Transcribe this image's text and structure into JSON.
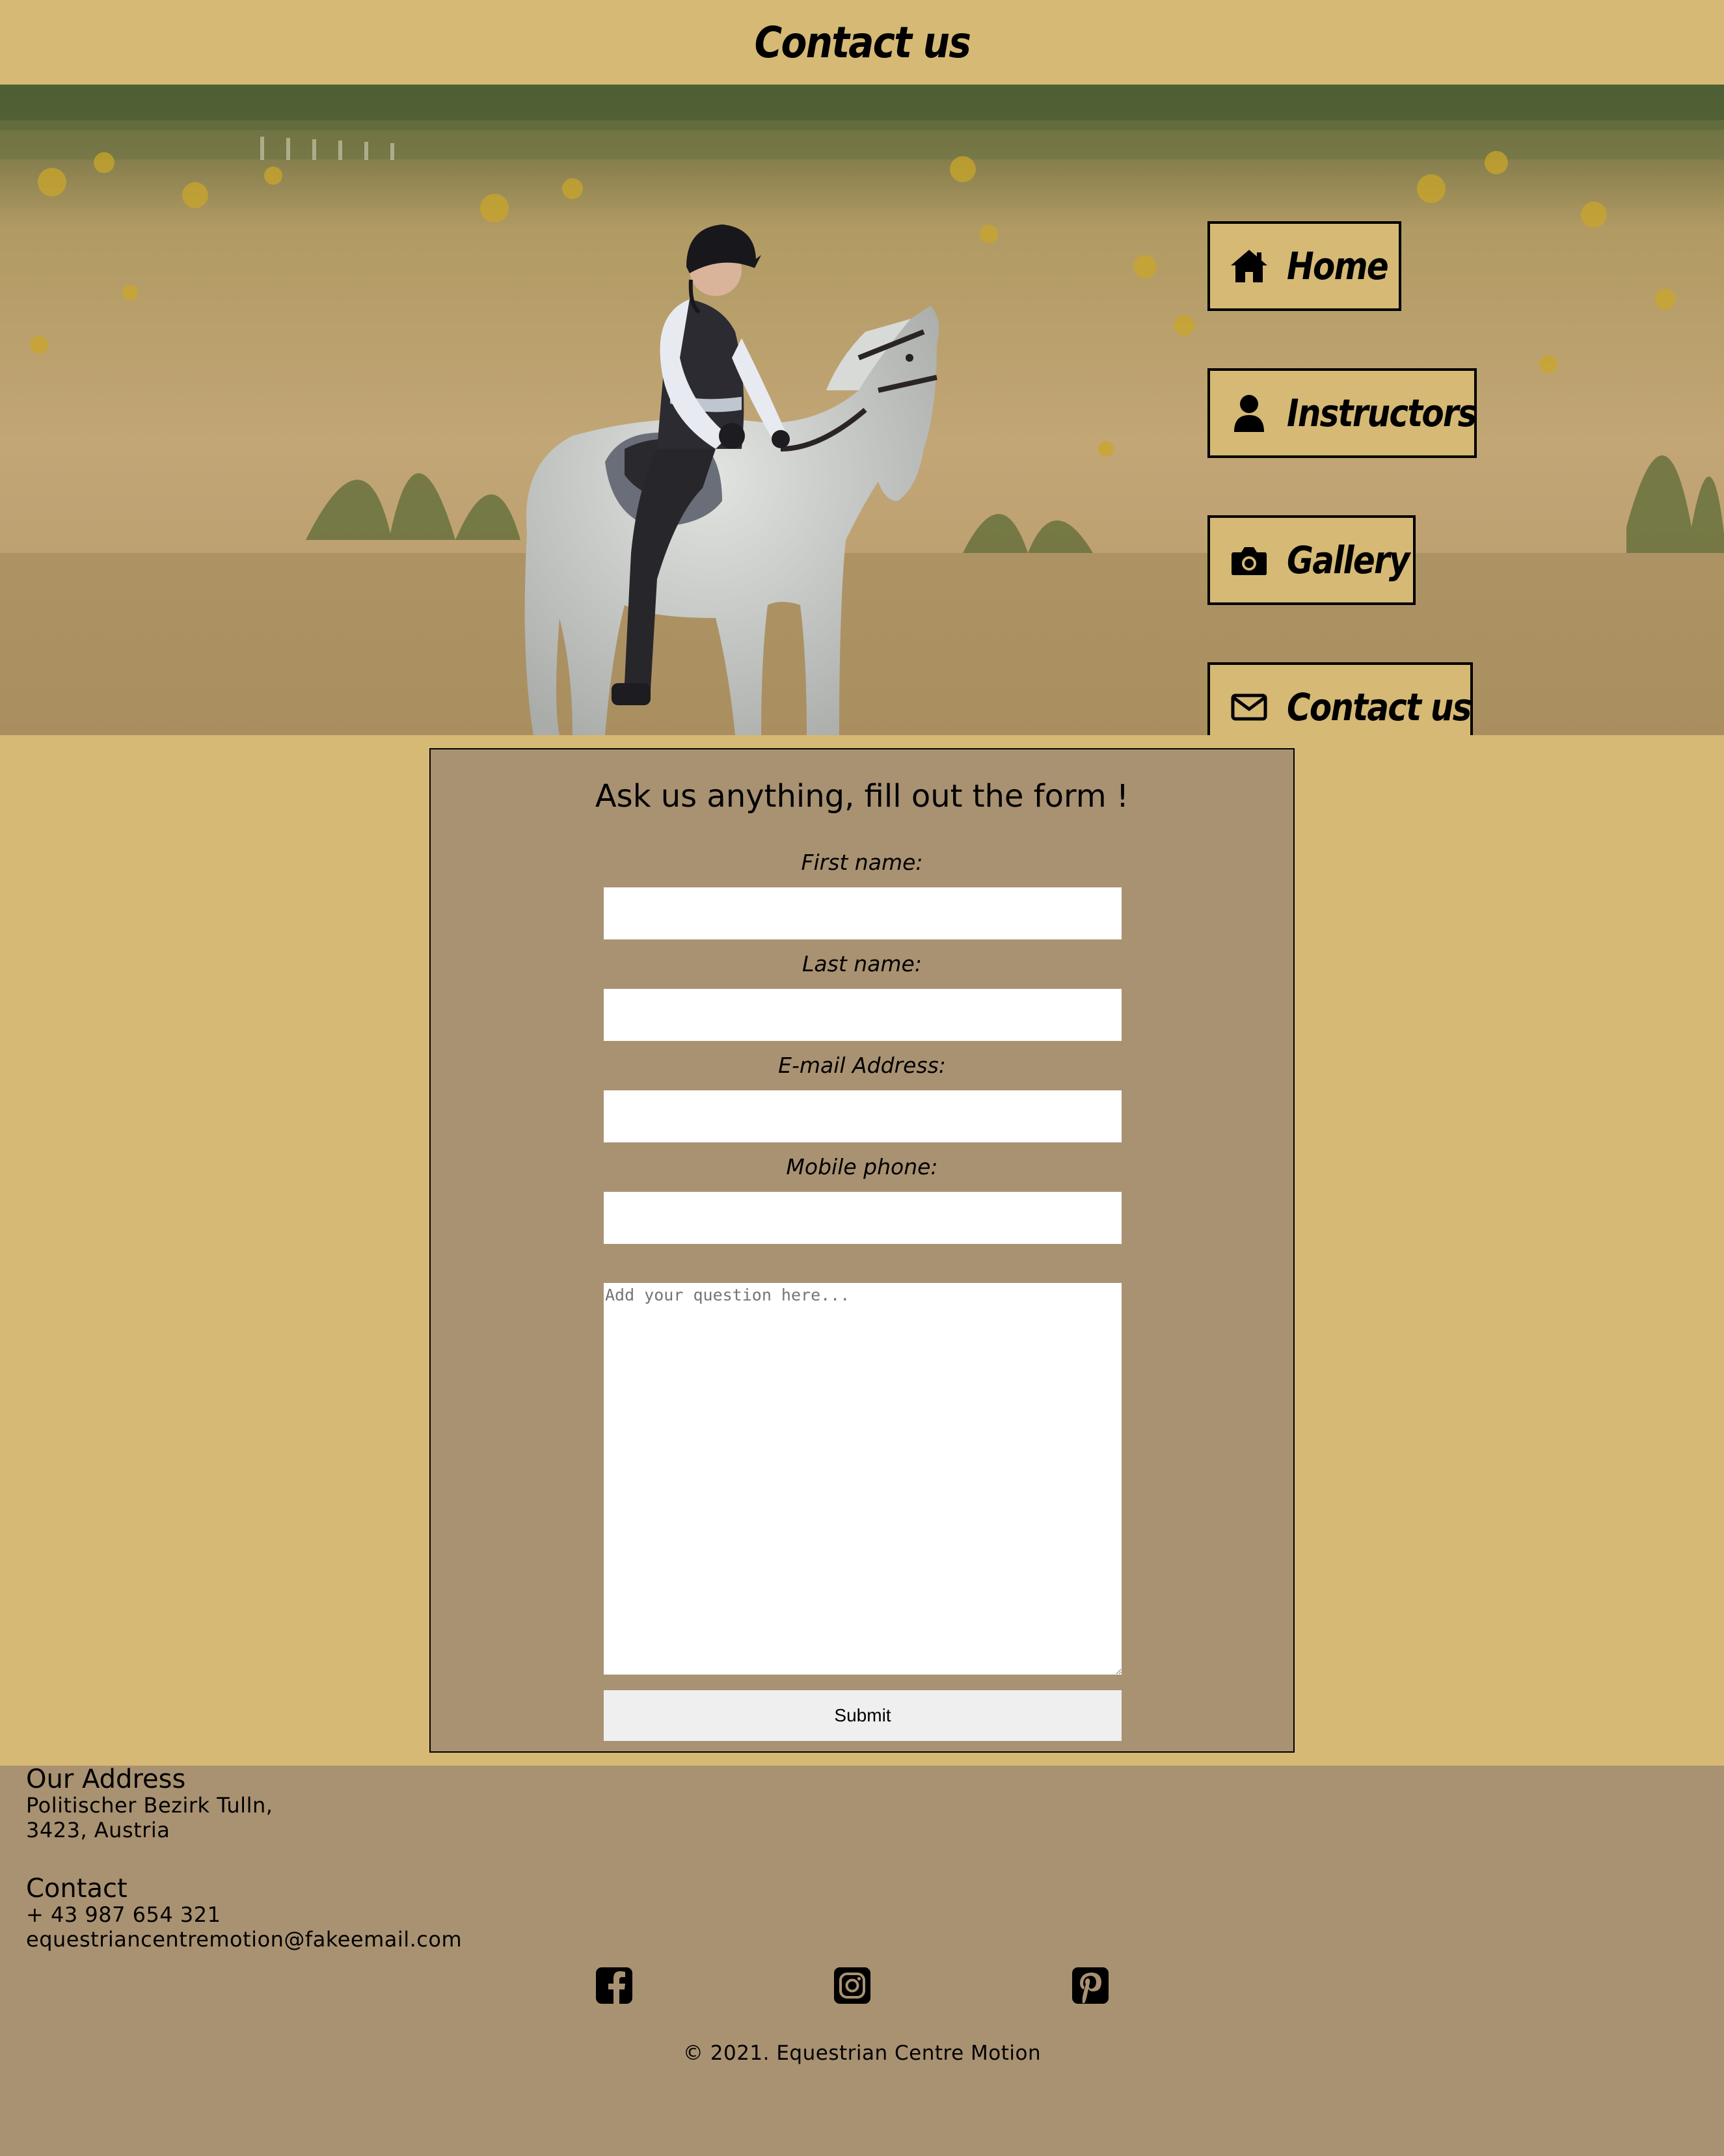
{
  "header": {
    "title": "Contact us"
  },
  "nav": {
    "items": [
      {
        "label": "Home",
        "icon": "home-icon"
      },
      {
        "label": "Instructors",
        "icon": "user-icon"
      },
      {
        "label": "Gallery",
        "icon": "camera-icon"
      },
      {
        "label": "Contact us",
        "icon": "envelope-icon"
      }
    ]
  },
  "form": {
    "title": "Ask us anything, fill out the form !",
    "first_name_label": "First name:",
    "last_name_label": "Last name:",
    "email_label": "E-mail Address:",
    "phone_label": "Mobile phone:",
    "first_name_value": "",
    "last_name_value": "",
    "email_value": "",
    "phone_value": "",
    "question_placeholder": "Add your question here...",
    "submit_label": "Submit"
  },
  "footer": {
    "address_heading": "Our Address",
    "address_line1": "Politischer Bezirk Tulln,",
    "address_line2": "3423, Austria",
    "contact_heading": "Contact",
    "phone": "+ 43 987 654 321",
    "email": "equestriancentremotion@fakeemail.com",
    "social": [
      "facebook-icon",
      "instagram-icon",
      "pinterest-icon"
    ],
    "copyright": "© 2021. Equestrian Centre Motion"
  },
  "colors": {
    "background": "#d5b975",
    "panel": "#a99272",
    "border": "#000000",
    "input": "#ffffff",
    "button": "#efefef"
  }
}
